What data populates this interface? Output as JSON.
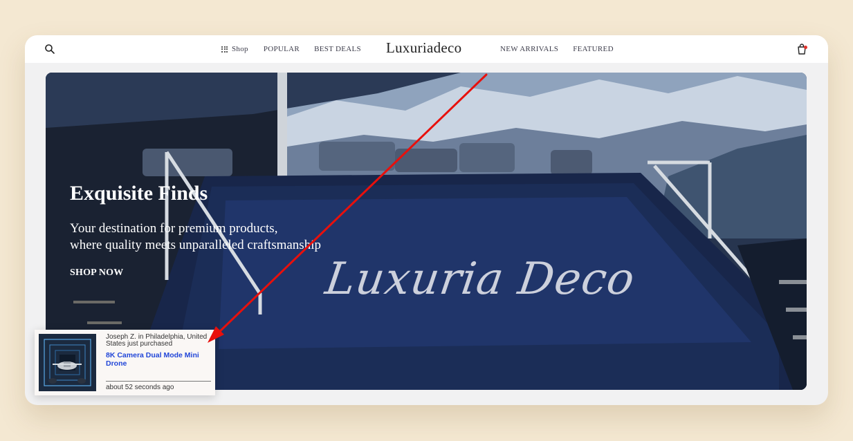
{
  "nav": {
    "shop_label": "Shop",
    "popular_label": "POPULAR",
    "best_deals_label": "BEST DEALS",
    "brand": "Luxuriadeco",
    "new_arrivals_label": "NEW ARRIVALS",
    "featured_label": "FEATURED",
    "search_icon": "search-icon",
    "bag_icon": "shopping-bag-icon"
  },
  "hero": {
    "title": "Exquisite Finds",
    "subtitle_line1": "Your destination for premium products,",
    "subtitle_line2": "where quality meets unparalleled craftsmanship",
    "cta": "SHOP NOW",
    "logo_text": "Luxuria Deco"
  },
  "toast": {
    "purchaser": "Joseph Z. in Philadelphia, United States just purchased",
    "product": "8K Camera Dual Mode Mini Drone",
    "time_ago": "about 52 seconds ago"
  },
  "colors": {
    "page_bg": "#f4e8d2",
    "annotation_arrow": "#e8100c",
    "toast_link": "#2146d8",
    "cart_badge": "#e4322b"
  }
}
